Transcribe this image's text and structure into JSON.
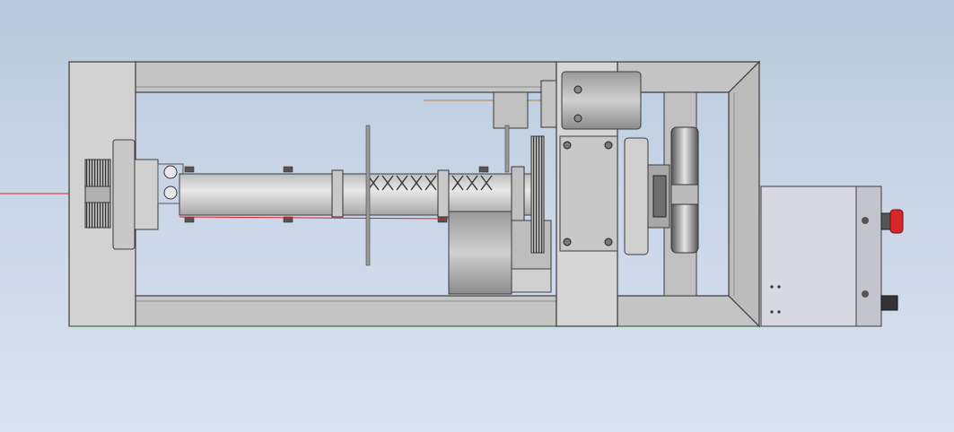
{
  "viewport": {
    "background_top": "#b9c8dc",
    "background_bottom": "#d8e2f0"
  },
  "model": {
    "parts": [
      "frame-left-end-plate",
      "frame-top-rail",
      "frame-bottom-rail",
      "frame-right-rail",
      "left-spur-gear",
      "left-flange-hub",
      "linear-shaft",
      "lead-screw-spring",
      "support-disk",
      "center-carriage-plate",
      "drive-motor",
      "bearing-hub",
      "roller-wheel",
      "control-box",
      "emergency-stop-button",
      "connector-port"
    ],
    "colors": {
      "steel_light": "#d4d4d4",
      "steel_mid": "#b4b4b4",
      "steel_dark": "#7a7a7a",
      "outline": "#3c3c3c",
      "estop_red": "#d8262a",
      "axis_red": "#e02020",
      "axis_gold": "#b8862a",
      "control_box": "#d8d8e2"
    }
  }
}
